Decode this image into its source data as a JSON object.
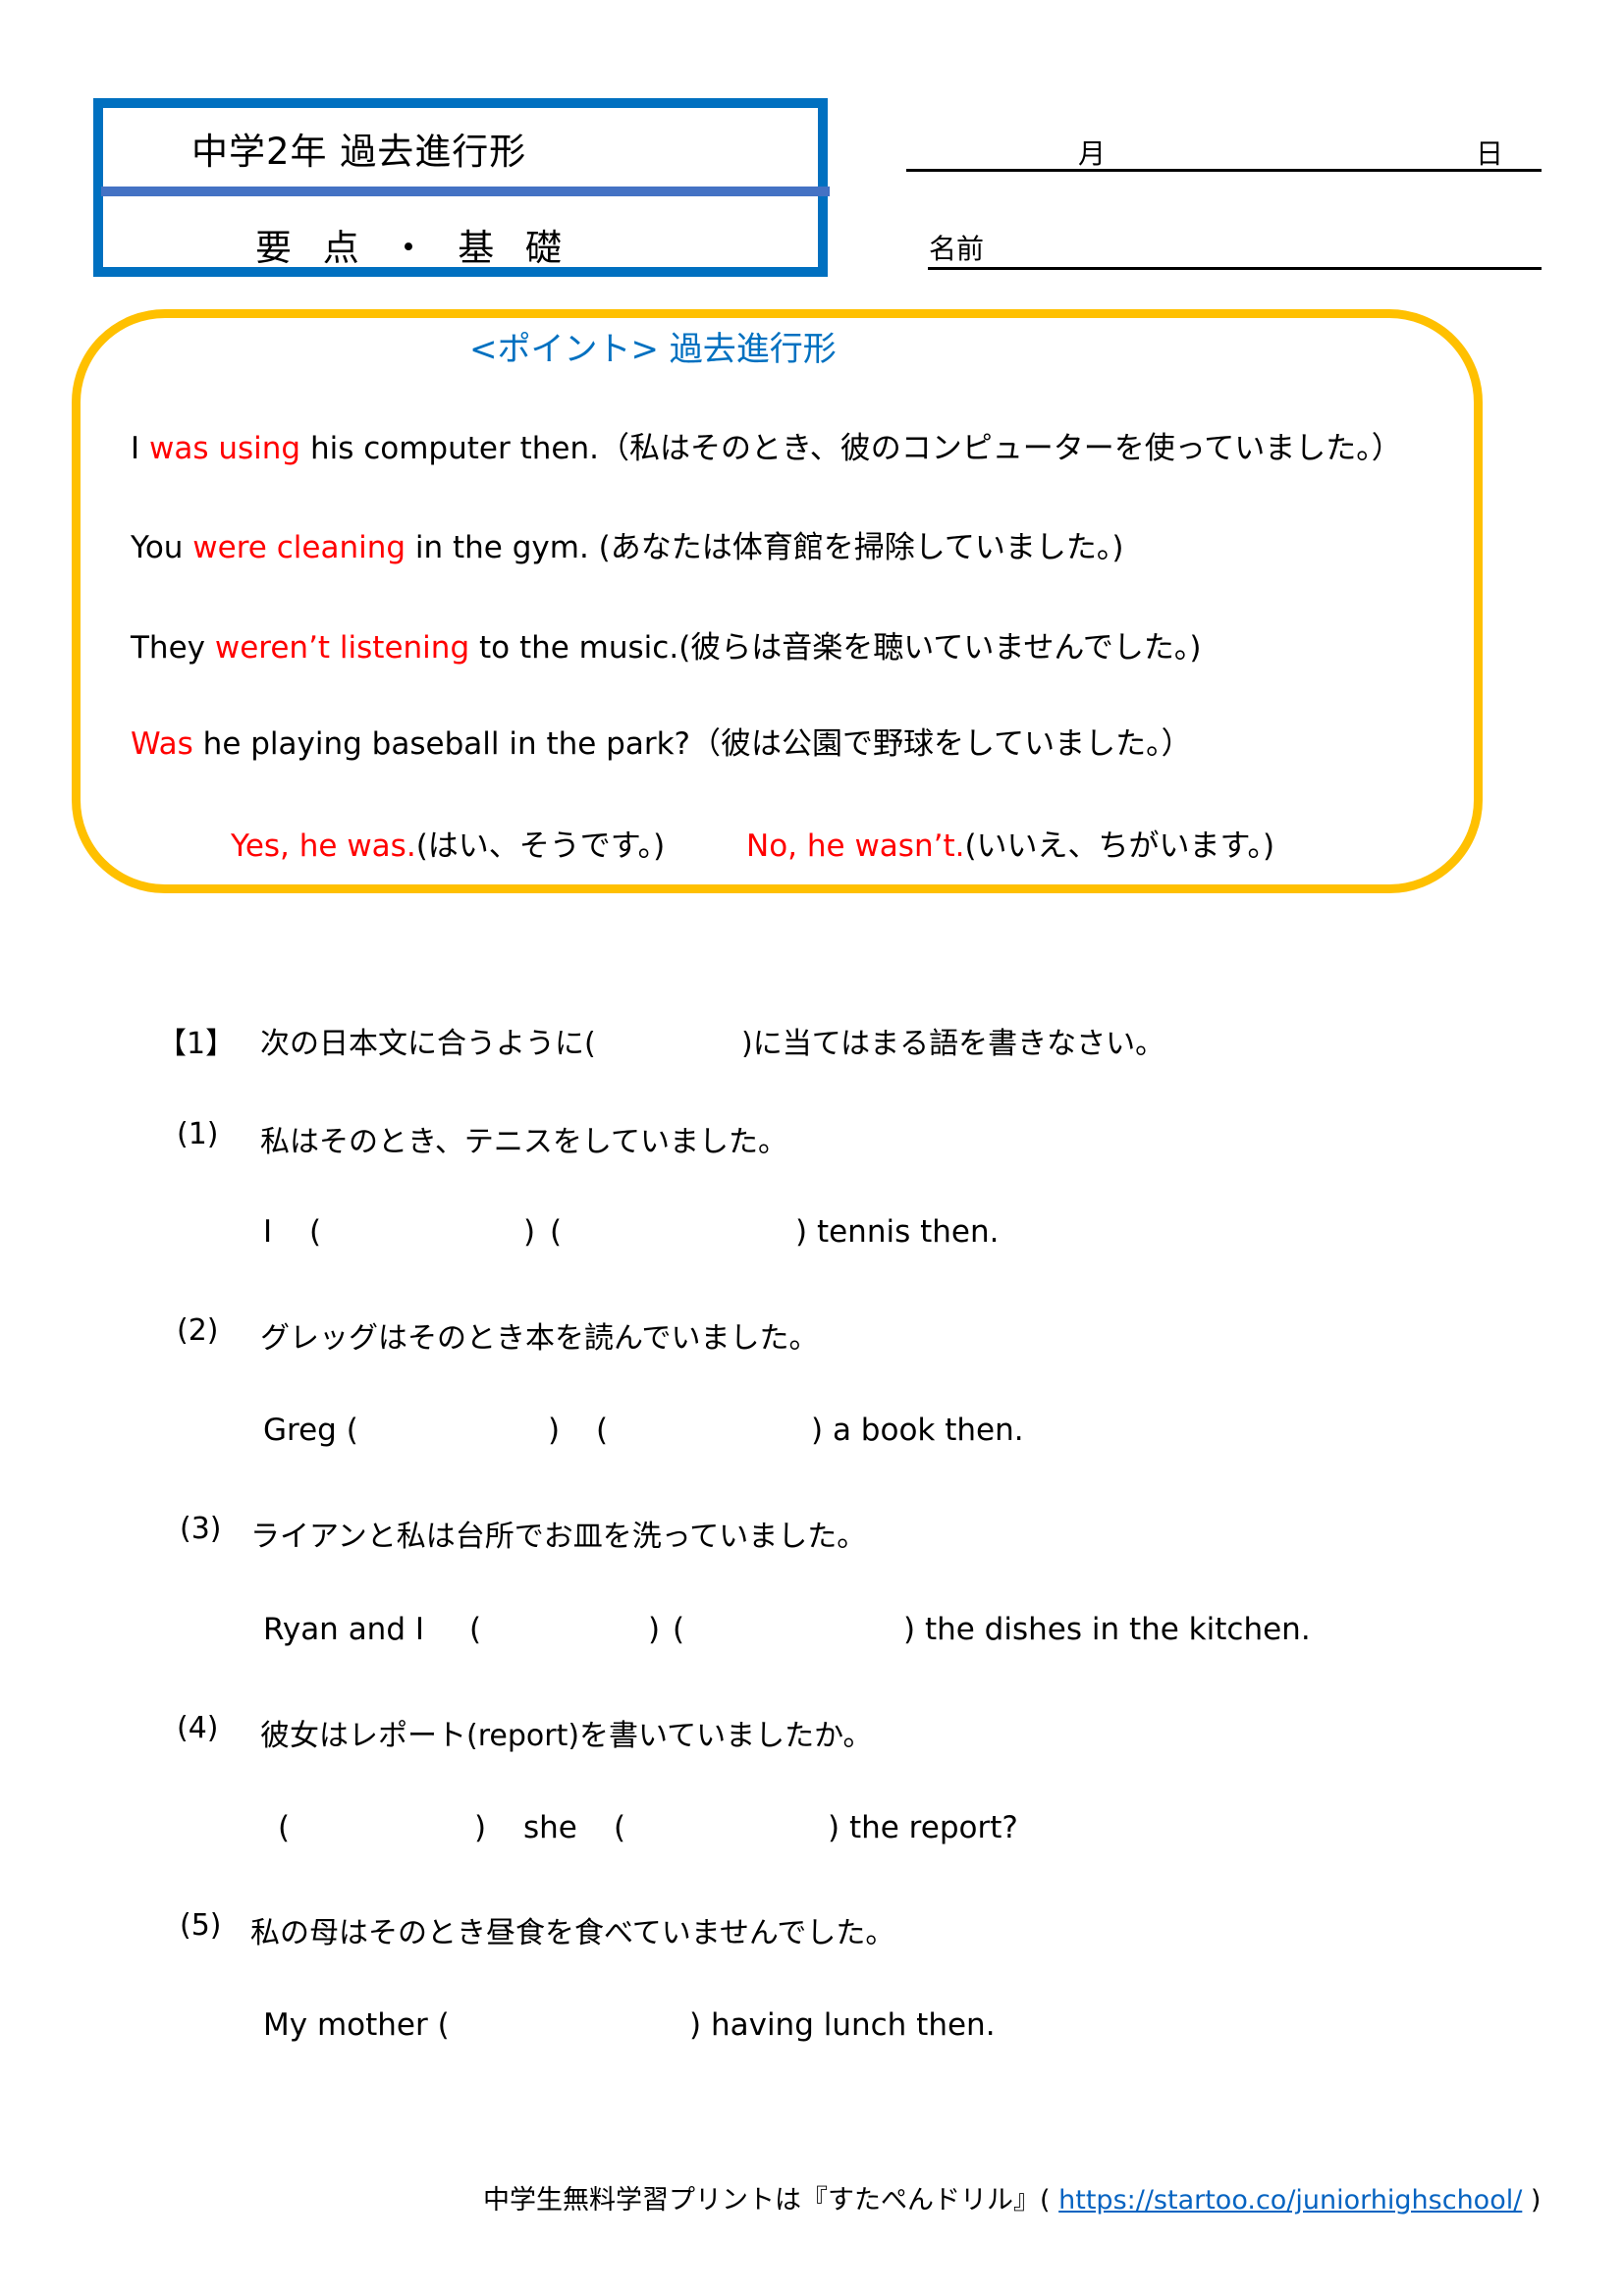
{
  "header": {
    "title": "中学2年 過去進行形",
    "subtitle": "要 点 ・ 基 礎",
    "month_label": "月",
    "day_label": "日",
    "name_label": "名前"
  },
  "point": {
    "title": "<ポイント> 過去進行形",
    "examples": [
      {
        "pre": "I ",
        "red": "was using",
        "post": " his computer then.（私はそのとき、彼のコンピューターを使っていました。）"
      },
      {
        "pre": "You ",
        "red": "were cleaning",
        "post": " in the gym. (あなたは体育館を掃除していました。)"
      },
      {
        "pre": "They ",
        "red": "weren’t listening",
        "post": " to the music.(彼らは音楽を聴いていませんでした。)"
      },
      {
        "pre": "",
        "red": "Was",
        "post": " he playing baseball in the park?（彼は公園で野球をしていました。）"
      }
    ],
    "answers": {
      "yes_red": "Yes, he was.",
      "yes_jp": "(はい、そうです。)",
      "no_red": "No, he wasn’t.",
      "no_jp": "(いいえ、ちがいます。)"
    }
  },
  "exercise": {
    "heading_num": "【1】",
    "heading_text_a": "次の日本文に合うように(",
    "heading_text_b": ")に当てはまる語を書きなさい。",
    "questions": [
      {
        "num": "(1)",
        "jp": "私はそのとき、テニスをしていました。",
        "parts": [
          "I",
          "(",
          ")",
          "(",
          ") tennis then."
        ]
      },
      {
        "num": "(2)",
        "jp": "グレッグはそのとき本を読んでいました。",
        "parts": [
          "Greg (",
          ")",
          "(",
          ") a book then."
        ]
      },
      {
        "num": "(3)",
        "jp": "ライアンと私は台所でお皿を洗っていました。",
        "parts": [
          "Ryan and I",
          "(",
          ")",
          "(",
          ") the dishes in the kitchen."
        ]
      },
      {
        "num": "(4)",
        "jp": "彼女はレポート(report)を書いていましたか。",
        "parts": [
          "(",
          ")",
          "she",
          "(",
          ") the report?"
        ]
      },
      {
        "num": "(5)",
        "jp": "私の母はそのとき昼食を食べていませんでした。",
        "parts": [
          "My mother (",
          ") having lunch then."
        ]
      }
    ]
  },
  "footer": {
    "text": "中学生無料学習プリントは『すたぺんドリル』(",
    "link": "https://startoo.co/juniorhighschool/",
    "close": ")"
  },
  "colors": {
    "title_box": "#0070C0",
    "title_divider": "#4472C4",
    "point_border": "#FFC000",
    "point_title": "#0070C0",
    "highlight": "#FF0000",
    "link": "#0563C1"
  }
}
